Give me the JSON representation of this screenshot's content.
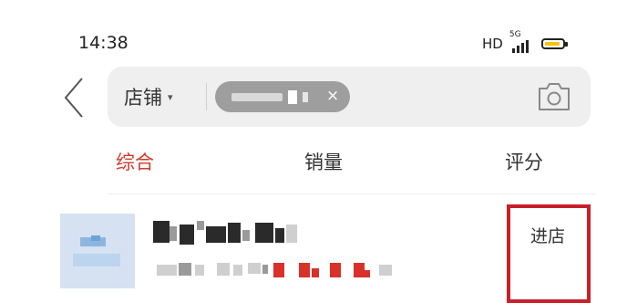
{
  "status_bar": {
    "time": "14:38",
    "hd_label": "HD",
    "network_label": "5G",
    "battery_color": "#f2c40f"
  },
  "search": {
    "back_icon": "chevron-left-icon",
    "scope_label": "店铺",
    "scope_caret": "▾",
    "chip_clear": "×",
    "camera_icon": "camera-icon"
  },
  "tabs": [
    {
      "label": "综合",
      "active": true
    },
    {
      "label": "销量",
      "active": false
    },
    {
      "label": "评分",
      "active": false
    }
  ],
  "result": {
    "enter_label": "进店",
    "accent_color": "#d33a2c",
    "annotation_color": "#c8202a"
  }
}
